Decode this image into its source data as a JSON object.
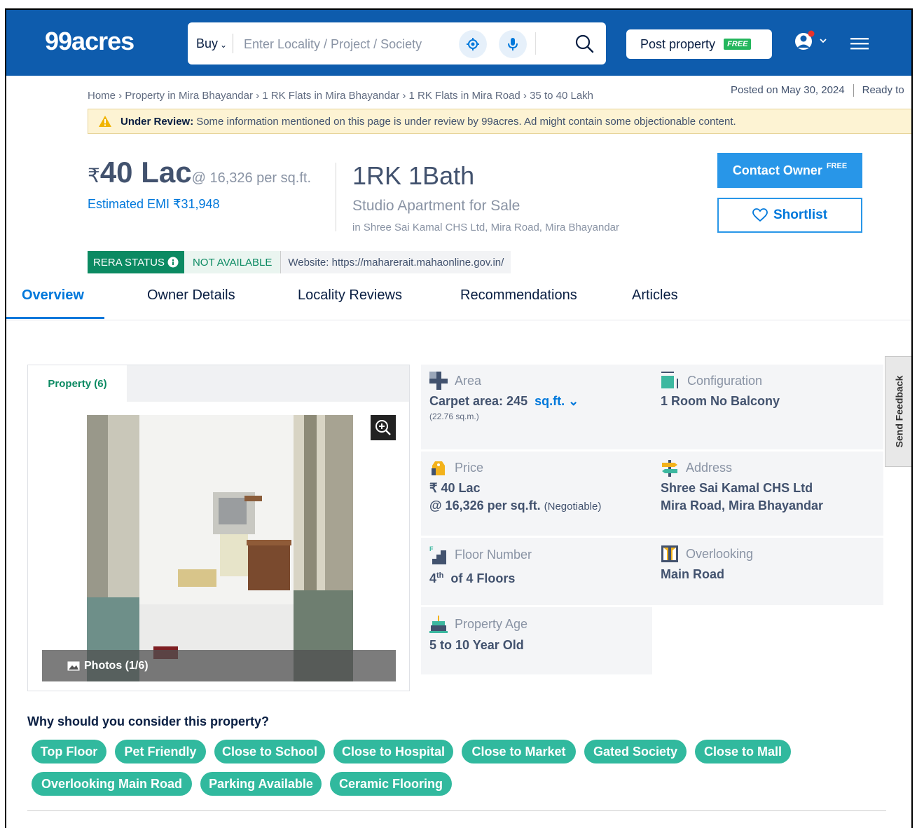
{
  "header": {
    "logo": "99acres",
    "search_mode": "Buy",
    "search_placeholder": "Enter Locality / Project / Society",
    "post_property": "Post property",
    "post_free_tag": "FREE"
  },
  "breadcrumb": {
    "items": [
      "Home ›",
      "Property in Mira Bhayandar ›",
      "1 RK Flats in Mira Bhayandar ›",
      "1 RK Flats in Mira Road ›",
      "35 to 40 Lakh"
    ],
    "posted_on": "Posted on May 30, 2024",
    "ready": "Ready to"
  },
  "review_notice": {
    "title": "Under Review:",
    "text": "Some information mentioned on this page is under review by 99acres. Ad might contain some objectionable content."
  },
  "listing": {
    "currency": "₹",
    "price": "40 Lac",
    "price_per_sqft": "@ 16,326 per sq.ft.",
    "emi_label": "Estimated EMI ₹31,948",
    "bhk": "1RK 1Bath",
    "type": "Studio Apartment for Sale",
    "location": "in Shree Sai Kamal CHS Ltd, Mira Road, Mira Bhayandar",
    "contact_btn": "Contact Owner",
    "contact_free": "FREE",
    "shortlist_btn": "Shortlist"
  },
  "rera": {
    "badge": "RERA STATUS",
    "status": "NOT AVAILABLE",
    "website": "Website: https://maharerait.mahaonline.gov.in/"
  },
  "tabs": [
    "Overview",
    "Owner Details",
    "Locality Reviews",
    "Recommendations",
    "Articles"
  ],
  "gallery": {
    "tab": "Property (6)",
    "photos_label": "Photos (1/6)"
  },
  "details": {
    "area": {
      "label": "Area",
      "value": "Carpet area: 245",
      "unit": "sq.ft.",
      "sub": "(22.76 sq.m.)"
    },
    "configuration": {
      "label": "Configuration",
      "value": "1 Room No Balcony"
    },
    "price": {
      "label": "Price",
      "value": "₹ 40 Lac",
      "value2": "@ 16,326 per sq.ft.",
      "negotiable": "(Negotiable)"
    },
    "address": {
      "label": "Address",
      "line1": "Shree Sai Kamal CHS Ltd",
      "line2": "Mira Road, Mira Bhayandar"
    },
    "floor": {
      "label": "Floor Number",
      "floor_num": "4",
      "suffix": "th",
      "of": "of 4 Floors"
    },
    "overlooking": {
      "label": "Overlooking",
      "value": "Main Road"
    },
    "age": {
      "label": "Property Age",
      "value": "5 to 10 Year Old"
    }
  },
  "feedback": "Send Feedback",
  "why": {
    "title": "Why should you consider this property?",
    "chips": [
      "Top Floor",
      "Pet Friendly",
      "Close to School",
      "Close to Hospital",
      "Close to Market",
      "Gated Society",
      "Close to Mall",
      "Overlooking Main Road",
      "Parking Available",
      "Ceramic Flooring"
    ]
  },
  "colors": {
    "brand": "#0e5cad",
    "accent": "#0078db",
    "chip": "#31b99e",
    "rera": "#0b8a62"
  }
}
